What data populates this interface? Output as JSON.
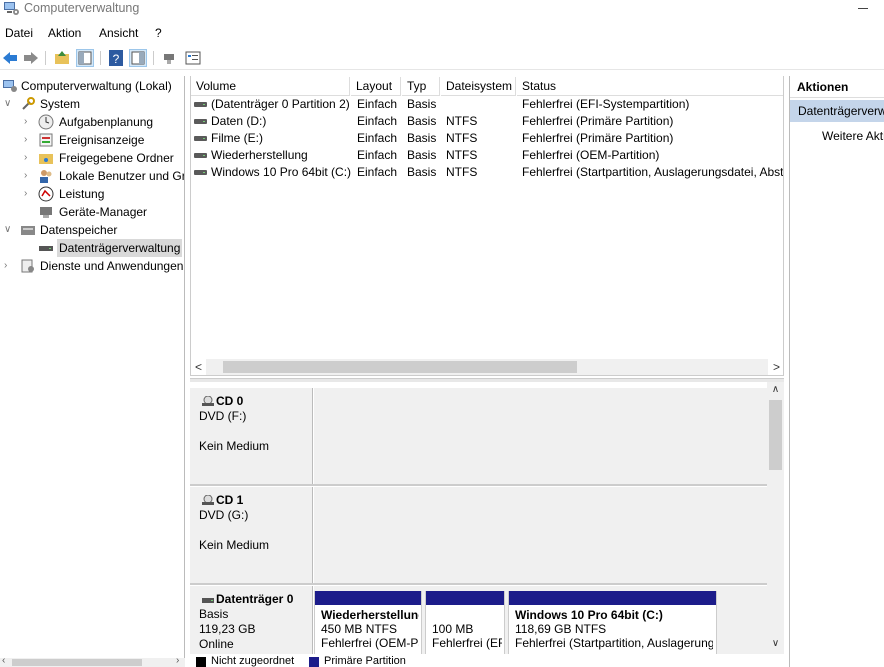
{
  "window": {
    "title": "Computerverwaltung"
  },
  "menu": [
    "Datei",
    "Aktion",
    "Ansicht",
    "?"
  ],
  "tree": {
    "root": "Computerverwaltung (Lokal)",
    "system": "System",
    "aufgaben": "Aufgabenplanung",
    "ereignis": "Ereignisanzeige",
    "freigabe": "Freigegebene Ordner",
    "benutzer": "Lokale Benutzer und Gruppen",
    "leistung": "Leistung",
    "geraete": "Geräte-Manager",
    "speicher": "Datenspeicher",
    "datentraeger": "Datenträgerverwaltung",
    "dienste": "Dienste und Anwendungen"
  },
  "volumes": {
    "headers": [
      "Volume",
      "Layout",
      "Typ",
      "Dateisystem",
      "Status"
    ],
    "rows": [
      [
        "(Datenträger 0 Partition 2)",
        "Einfach",
        "Basis",
        "",
        "Fehlerfrei (EFI-Systempartition)"
      ],
      [
        "Daten (D:)",
        "Einfach",
        "Basis",
        "NTFS",
        "Fehlerfrei (Primäre Partition)"
      ],
      [
        "Filme (E:)",
        "Einfach",
        "Basis",
        "NTFS",
        "Fehlerfrei (Primäre Partition)"
      ],
      [
        "Wiederherstellung",
        "Einfach",
        "Basis",
        "NTFS",
        "Fehlerfrei (OEM-Partition)"
      ],
      [
        "Windows 10 Pro 64bit (C:)",
        "Einfach",
        "Basis",
        "NTFS",
        "Fehlerfrei (Startpartition, Auslagerungsdatei, Absturzabbild, Primäre Partition)"
      ]
    ]
  },
  "disks": [
    {
      "name": "CD 0",
      "type": "DVD (F:)",
      "status": "Kein Medium"
    },
    {
      "name": "CD 1",
      "type": "DVD (G:)",
      "status": "Kein Medium"
    },
    {
      "name": "Datenträger 0",
      "type": "Basis",
      "size": "119,23 GB",
      "status": "Online",
      "partitions": [
        {
          "name": "Wiederherstellung",
          "size": "450 MB NTFS",
          "status": "Fehlerfrei (OEM-Partition)"
        },
        {
          "name": "",
          "size": "100 MB",
          "status": "Fehlerfrei (EFI-Systempartition)"
        },
        {
          "name": "Windows 10 Pro 64bit  (C:)",
          "size": "118,69 GB NTFS",
          "status": "Fehlerfrei (Startpartition, Auslagerungsdatei, Absturzabbild)"
        }
      ]
    }
  ],
  "legend": [
    {
      "label": "Nicht zugeordnet",
      "color": "#000000"
    },
    {
      "label": "Primäre Partition",
      "color": "#1c1c8a"
    }
  ],
  "actions": {
    "header": "Aktionen",
    "section": "Datenträgerverwaltung",
    "item": "Weitere Aktionen"
  },
  "colors": {
    "partition_bar": "#1c1c8a",
    "selection": "#c4d5ea"
  }
}
